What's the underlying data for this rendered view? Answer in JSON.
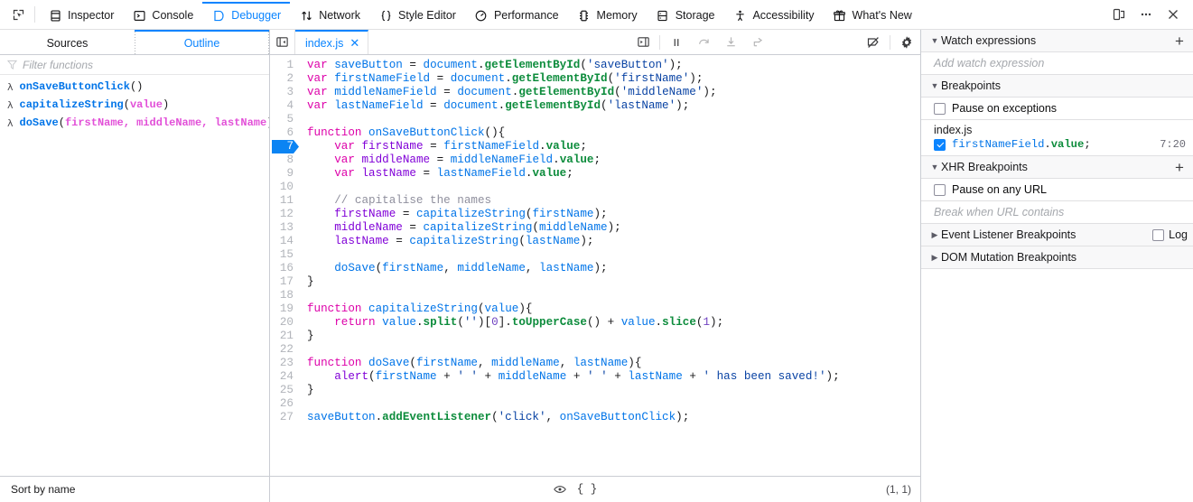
{
  "toolbar": {
    "picker_icon": "element-picker-icon",
    "tabs": [
      {
        "label": "Inspector",
        "icon": "inspector-icon",
        "selected": false
      },
      {
        "label": "Console",
        "icon": "console-icon",
        "selected": false
      },
      {
        "label": "Debugger",
        "icon": "debugger-icon",
        "selected": true
      },
      {
        "label": "Network",
        "icon": "network-icon",
        "selected": false
      },
      {
        "label": "Style Editor",
        "icon": "style-editor-icon",
        "selected": false
      },
      {
        "label": "Performance",
        "icon": "performance-icon",
        "selected": false
      },
      {
        "label": "Memory",
        "icon": "memory-icon",
        "selected": false
      },
      {
        "label": "Storage",
        "icon": "storage-icon",
        "selected": false
      },
      {
        "label": "Accessibility",
        "icon": "accessibility-icon",
        "selected": false
      },
      {
        "label": "What's New",
        "icon": "whats-new-icon",
        "selected": false
      }
    ],
    "responsive_icon": "responsive-design-mode-icon",
    "meatball_icon": "more-options-icon",
    "close_icon": "close-icon",
    "accent_color": "#0a84ff"
  },
  "left_pane": {
    "tabs": [
      {
        "label": "Sources",
        "selected": false
      },
      {
        "label": "Outline",
        "selected": true
      }
    ],
    "filter_placeholder": "Filter functions",
    "filter_icon": "filter-funnel-icon",
    "outline_items": [
      {
        "marker": "λ",
        "name": "onSaveButtonClick",
        "args": ""
      },
      {
        "marker": "λ",
        "name": "capitalizeString",
        "args": "value"
      },
      {
        "marker": "λ",
        "name": "doSave",
        "args": "firstName, middleName, lastName"
      }
    ],
    "footer_label": "Sort by name"
  },
  "editor": {
    "prettyprint_icon": "toggle-sources-pane-icon",
    "tab_label": "index.js",
    "tab_close_icon": "close-tab-icon",
    "controls": [
      {
        "name": "pause-button",
        "icon": "pause-icon",
        "disabled": false
      },
      {
        "name": "step-over-button",
        "icon": "step-over-icon",
        "disabled": true
      },
      {
        "name": "step-in-button",
        "icon": "step-in-icon",
        "disabled": true
      },
      {
        "name": "step-out-button",
        "icon": "step-out-icon",
        "disabled": true
      }
    ],
    "deactivate_breakpoints_icon": "deactivate-breakpoints-icon",
    "settings_icon": "gear-icon",
    "expand_panes_icon": "expand-panes-icon",
    "breakpoint_line": 7,
    "footer": {
      "watch_icon": "eye-icon",
      "prettyprint_icon": "pretty-print-braces-icon",
      "prettyprint_label": "{ }",
      "cursor_position": "(1, 1)"
    },
    "lines": [
      {
        "n": 1,
        "tokens": [
          [
            "t-kw",
            "var"
          ],
          [
            "t-pun",
            " "
          ],
          [
            "t-var",
            "saveButton"
          ],
          [
            "t-pun",
            " = "
          ],
          [
            "t-var",
            "document"
          ],
          [
            "t-pun",
            "."
          ],
          [
            "t-prop",
            "getElementById"
          ],
          [
            "t-pun",
            "("
          ],
          [
            "t-str",
            "'saveButton'"
          ],
          [
            "t-pun",
            ");"
          ]
        ]
      },
      {
        "n": 2,
        "tokens": [
          [
            "t-kw",
            "var"
          ],
          [
            "t-pun",
            " "
          ],
          [
            "t-var",
            "firstNameField"
          ],
          [
            "t-pun",
            " = "
          ],
          [
            "t-var",
            "document"
          ],
          [
            "t-pun",
            "."
          ],
          [
            "t-prop",
            "getElementById"
          ],
          [
            "t-pun",
            "("
          ],
          [
            "t-str",
            "'firstName'"
          ],
          [
            "t-pun",
            ");"
          ]
        ]
      },
      {
        "n": 3,
        "tokens": [
          [
            "t-kw",
            "var"
          ],
          [
            "t-pun",
            " "
          ],
          [
            "t-var",
            "middleNameField"
          ],
          [
            "t-pun",
            " = "
          ],
          [
            "t-var",
            "document"
          ],
          [
            "t-pun",
            "."
          ],
          [
            "t-prop",
            "getElementById"
          ],
          [
            "t-pun",
            "("
          ],
          [
            "t-str",
            "'middleName'"
          ],
          [
            "t-pun",
            ");"
          ]
        ]
      },
      {
        "n": 4,
        "tokens": [
          [
            "t-kw",
            "var"
          ],
          [
            "t-pun",
            " "
          ],
          [
            "t-var",
            "lastNameField"
          ],
          [
            "t-pun",
            " = "
          ],
          [
            "t-var",
            "document"
          ],
          [
            "t-pun",
            "."
          ],
          [
            "t-prop",
            "getElementById"
          ],
          [
            "t-pun",
            "("
          ],
          [
            "t-str",
            "'lastName'"
          ],
          [
            "t-pun",
            ");"
          ]
        ]
      },
      {
        "n": 5,
        "tokens": []
      },
      {
        "n": 6,
        "tokens": [
          [
            "t-kw",
            "function"
          ],
          [
            "t-pun",
            " "
          ],
          [
            "t-fnname",
            "onSaveButtonClick"
          ],
          [
            "t-pun",
            "(){"
          ]
        ]
      },
      {
        "n": 7,
        "bp": true,
        "tokens": [
          [
            "t-pun",
            "    "
          ],
          [
            "t-kw",
            "var"
          ],
          [
            "t-pun",
            " "
          ],
          [
            "t-def",
            "firstName"
          ],
          [
            "t-pun",
            " = "
          ],
          [
            "t-var",
            "firstNameField"
          ],
          [
            "t-pun",
            "."
          ],
          [
            "t-prop",
            "value"
          ],
          [
            "t-pun",
            ";"
          ]
        ]
      },
      {
        "n": 8,
        "tokens": [
          [
            "t-pun",
            "    "
          ],
          [
            "t-kw",
            "var"
          ],
          [
            "t-pun",
            " "
          ],
          [
            "t-def",
            "middleName"
          ],
          [
            "t-pun",
            " = "
          ],
          [
            "t-var",
            "middleNameField"
          ],
          [
            "t-pun",
            "."
          ],
          [
            "t-prop",
            "value"
          ],
          [
            "t-pun",
            ";"
          ]
        ]
      },
      {
        "n": 9,
        "tokens": [
          [
            "t-pun",
            "    "
          ],
          [
            "t-kw",
            "var"
          ],
          [
            "t-pun",
            " "
          ],
          [
            "t-def",
            "lastName"
          ],
          [
            "t-pun",
            " = "
          ],
          [
            "t-var",
            "lastNameField"
          ],
          [
            "t-pun",
            "."
          ],
          [
            "t-prop",
            "value"
          ],
          [
            "t-pun",
            ";"
          ]
        ]
      },
      {
        "n": 10,
        "tokens": []
      },
      {
        "n": 11,
        "tokens": [
          [
            "t-pun",
            "    "
          ],
          [
            "t-cmt",
            "// capitalise the names"
          ]
        ]
      },
      {
        "n": 12,
        "tokens": [
          [
            "t-pun",
            "    "
          ],
          [
            "t-def",
            "firstName"
          ],
          [
            "t-pun",
            " = "
          ],
          [
            "t-fnname",
            "capitalizeString"
          ],
          [
            "t-pun",
            "("
          ],
          [
            "t-var",
            "firstName"
          ],
          [
            "t-pun",
            ");"
          ]
        ]
      },
      {
        "n": 13,
        "tokens": [
          [
            "t-pun",
            "    "
          ],
          [
            "t-def",
            "middleName"
          ],
          [
            "t-pun",
            " = "
          ],
          [
            "t-fnname",
            "capitalizeString"
          ],
          [
            "t-pun",
            "("
          ],
          [
            "t-var",
            "middleName"
          ],
          [
            "t-pun",
            ");"
          ]
        ]
      },
      {
        "n": 14,
        "tokens": [
          [
            "t-pun",
            "    "
          ],
          [
            "t-def",
            "lastName"
          ],
          [
            "t-pun",
            " = "
          ],
          [
            "t-fnname",
            "capitalizeString"
          ],
          [
            "t-pun",
            "("
          ],
          [
            "t-var",
            "lastName"
          ],
          [
            "t-pun",
            ");"
          ]
        ]
      },
      {
        "n": 15,
        "tokens": []
      },
      {
        "n": 16,
        "tokens": [
          [
            "t-pun",
            "    "
          ],
          [
            "t-fnname",
            "doSave"
          ],
          [
            "t-pun",
            "("
          ],
          [
            "t-var",
            "firstName"
          ],
          [
            "t-pun",
            ", "
          ],
          [
            "t-var",
            "middleName"
          ],
          [
            "t-pun",
            ", "
          ],
          [
            "t-var",
            "lastName"
          ],
          [
            "t-pun",
            ");"
          ]
        ]
      },
      {
        "n": 17,
        "tokens": [
          [
            "t-pun",
            "}"
          ]
        ]
      },
      {
        "n": 18,
        "tokens": []
      },
      {
        "n": 19,
        "tokens": [
          [
            "t-kw",
            "function"
          ],
          [
            "t-pun",
            " "
          ],
          [
            "t-fnname",
            "capitalizeString"
          ],
          [
            "t-pun",
            "("
          ],
          [
            "t-var",
            "value"
          ],
          [
            "t-pun",
            "){"
          ]
        ]
      },
      {
        "n": 20,
        "tokens": [
          [
            "t-pun",
            "    "
          ],
          [
            "t-kw",
            "return"
          ],
          [
            "t-pun",
            " "
          ],
          [
            "t-var",
            "value"
          ],
          [
            "t-pun",
            "."
          ],
          [
            "t-prop",
            "split"
          ],
          [
            "t-pun",
            "("
          ],
          [
            "t-str",
            "''"
          ],
          [
            "t-pun",
            ")["
          ],
          [
            "t-num",
            "0"
          ],
          [
            "t-pun",
            "]."
          ],
          [
            "t-prop",
            "toUpperCase"
          ],
          [
            "t-pun",
            "() + "
          ],
          [
            "t-var",
            "value"
          ],
          [
            "t-pun",
            "."
          ],
          [
            "t-prop",
            "slice"
          ],
          [
            "t-pun",
            "("
          ],
          [
            "t-num",
            "1"
          ],
          [
            "t-pun",
            ");"
          ]
        ]
      },
      {
        "n": 21,
        "tokens": [
          [
            "t-pun",
            "}"
          ]
        ]
      },
      {
        "n": 22,
        "tokens": []
      },
      {
        "n": 23,
        "tokens": [
          [
            "t-kw",
            "function"
          ],
          [
            "t-pun",
            " "
          ],
          [
            "t-fnname",
            "doSave"
          ],
          [
            "t-pun",
            "("
          ],
          [
            "t-var",
            "firstName"
          ],
          [
            "t-pun",
            ", "
          ],
          [
            "t-var",
            "middleName"
          ],
          [
            "t-pun",
            ", "
          ],
          [
            "t-var",
            "lastName"
          ],
          [
            "t-pun",
            "){"
          ]
        ]
      },
      {
        "n": 24,
        "tokens": [
          [
            "t-pun",
            "    "
          ],
          [
            "t-def",
            "alert"
          ],
          [
            "t-pun",
            "("
          ],
          [
            "t-var",
            "firstName"
          ],
          [
            "t-pun",
            " + "
          ],
          [
            "t-str",
            "' '"
          ],
          [
            "t-pun",
            " + "
          ],
          [
            "t-var",
            "middleName"
          ],
          [
            "t-pun",
            " + "
          ],
          [
            "t-str",
            "' '"
          ],
          [
            "t-pun",
            " + "
          ],
          [
            "t-var",
            "lastName"
          ],
          [
            "t-pun",
            " + "
          ],
          [
            "t-str",
            "' has been saved!'"
          ],
          [
            "t-pun",
            ");"
          ]
        ]
      },
      {
        "n": 25,
        "tokens": [
          [
            "t-pun",
            "}"
          ]
        ]
      },
      {
        "n": 26,
        "tokens": []
      },
      {
        "n": 27,
        "tokens": [
          [
            "t-var",
            "saveButton"
          ],
          [
            "t-pun",
            "."
          ],
          [
            "t-prop",
            "addEventListener"
          ],
          [
            "t-pun",
            "("
          ],
          [
            "t-str",
            "'click'"
          ],
          [
            "t-pun",
            ", "
          ],
          [
            "t-var",
            "onSaveButtonClick"
          ],
          [
            "t-pun",
            ");"
          ]
        ]
      }
    ]
  },
  "right_pane": {
    "watch": {
      "title": "Watch expressions",
      "add_icon": "plus-icon",
      "placeholder": "Add watch expression",
      "expanded": true
    },
    "breakpoints": {
      "title": "Breakpoints",
      "expanded": true,
      "pause_on_exceptions_label": "Pause on exceptions",
      "pause_on_exceptions_checked": false,
      "file": "index.js",
      "items": [
        {
          "checked": true,
          "code_tokens": [
            [
              "t-var",
              "firstNameField"
            ],
            [
              "t-pun",
              "."
            ],
            [
              "t-prop",
              "value"
            ],
            [
              "t-pun",
              ";"
            ]
          ],
          "location": "7:20"
        }
      ]
    },
    "xhr": {
      "title": "XHR Breakpoints",
      "add_icon": "plus-icon",
      "expanded": true,
      "pause_on_any_url_label": "Pause on any URL",
      "pause_on_any_url_checked": false,
      "url_placeholder": "Break when URL contains"
    },
    "event_listener": {
      "title": "Event Listener Breakpoints",
      "expanded": false,
      "log_label": "Log",
      "log_checked": false
    },
    "dom_mutation": {
      "title": "DOM Mutation Breakpoints",
      "expanded": false
    }
  }
}
